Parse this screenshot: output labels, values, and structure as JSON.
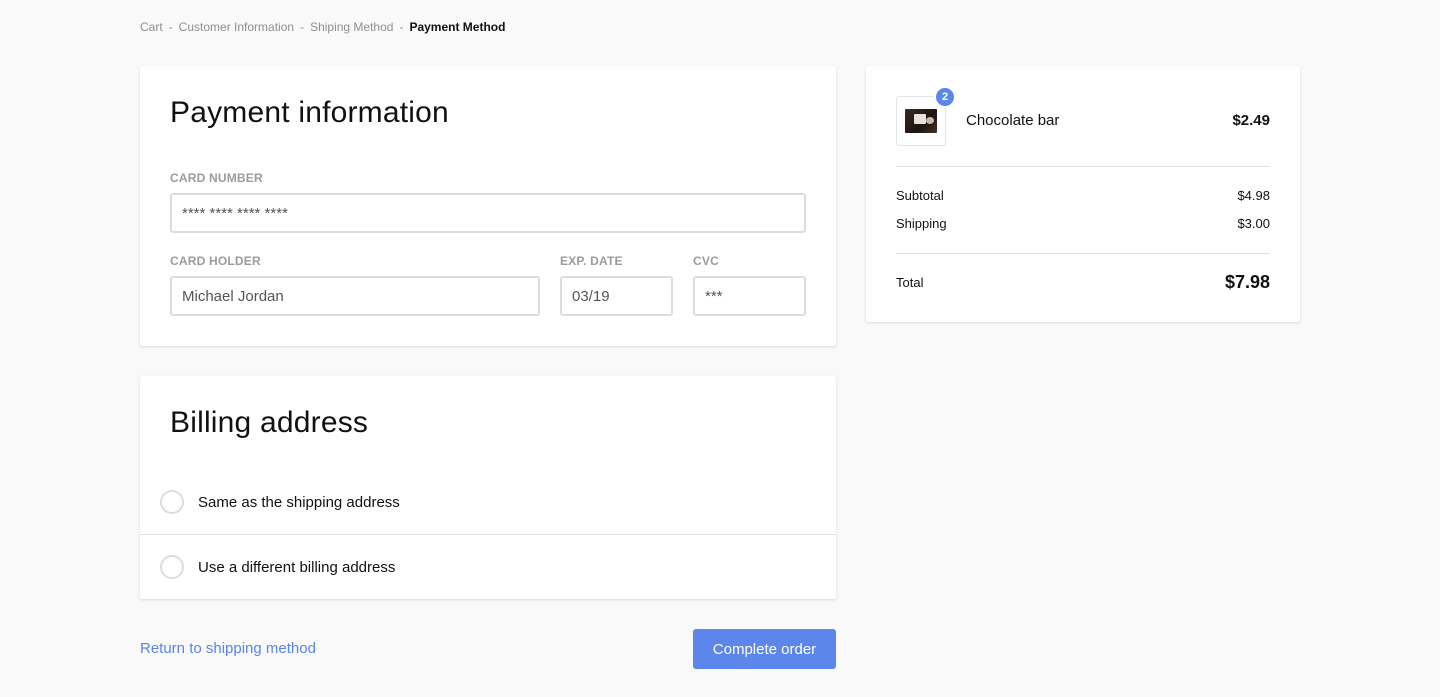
{
  "breadcrumb": {
    "items": [
      "Cart",
      "Customer Information",
      "Shiping Method",
      "Payment Method"
    ],
    "separator": "-"
  },
  "payment": {
    "title": "Payment information",
    "card_number": {
      "label": "CARD NUMBER",
      "placeholder": "**** **** **** ****"
    },
    "card_holder": {
      "label": "CARD HOLDER",
      "placeholder": "Michael Jordan"
    },
    "exp_date": {
      "label": "EXP. DATE",
      "placeholder": "03/19"
    },
    "cvc": {
      "label": "CVC",
      "placeholder": "***"
    }
  },
  "billing": {
    "title": "Billing address",
    "options": [
      {
        "label": "Same as the shipping address"
      },
      {
        "label": "Use a different billing address"
      }
    ]
  },
  "actions": {
    "return_label": "Return to shipping method",
    "complete_label": "Complete order"
  },
  "summary": {
    "product": {
      "name": "Chocolate bar",
      "price": "$2.49",
      "quantity": "2",
      "thumbnail_icon": "chocolate-bar-image"
    },
    "subtotal": {
      "label": "Subtotal",
      "value": "$4.98"
    },
    "shipping": {
      "label": "Shipping",
      "value": "$3.00"
    },
    "total": {
      "label": "Total",
      "value": "$7.98"
    }
  },
  "colors": {
    "accent": "#5d86ea",
    "link": "#5a84e8",
    "background": "#f9f9f9"
  }
}
